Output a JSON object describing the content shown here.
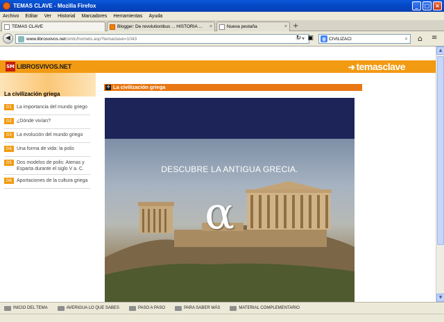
{
  "window": {
    "title": "TEMAS CLAVE - Mozilla Firefox"
  },
  "menu": [
    "Archivo",
    "Editar",
    "Ver",
    "Historial",
    "Marcadores",
    "Herramientas",
    "Ayuda"
  ],
  "tabs": [
    {
      "label": "TEMAS CLAVE"
    },
    {
      "label": "Blogger: De revolutionibus ... HISTORIA ..."
    },
    {
      "label": "Nueva pestaña"
    }
  ],
  "address": {
    "host": "www.librosvivos.net",
    "path": "/smtc/homets.asp?temaclave=1043"
  },
  "search": {
    "value": "CIVILIZACI"
  },
  "site": {
    "logo_left": "LIBROSVIVOS.NET",
    "logo_mark": "SM",
    "logo_right": "temasclave"
  },
  "sidebar": {
    "title": "La civilización griega",
    "items": [
      {
        "num": "01",
        "label": "La importancia del mundo griego"
      },
      {
        "num": "02",
        "label": "¿Dónde vivían?"
      },
      {
        "num": "03",
        "label": "La evolución del mundo griego"
      },
      {
        "num": "04",
        "label": "Una forma de vida: la polis"
      },
      {
        "num": "05",
        "label": "Dos modelos de polis: Atenas y Esparta durante el siglo V a. C."
      },
      {
        "num": "06",
        "label": "Aportaciones de la cultura griega"
      }
    ]
  },
  "main": {
    "section_title": "La civilización griega",
    "hero_heading": "DESCUBRE LA ANTIGUA GRECIA.",
    "hero_symbol": "α"
  },
  "toolbar": {
    "items": [
      {
        "label": "INICIO DEL TEMA"
      },
      {
        "label": "AVERIGUA LO QUE SABES"
      },
      {
        "label": "PASO A PASO"
      },
      {
        "label": "PARA SABER MÁS"
      },
      {
        "label": "MATERIAL COMPLEMENTARIO"
      }
    ]
  },
  "colors": {
    "accent": "#f29a12",
    "section": "#e87714",
    "titlebar": "#0447c5"
  }
}
